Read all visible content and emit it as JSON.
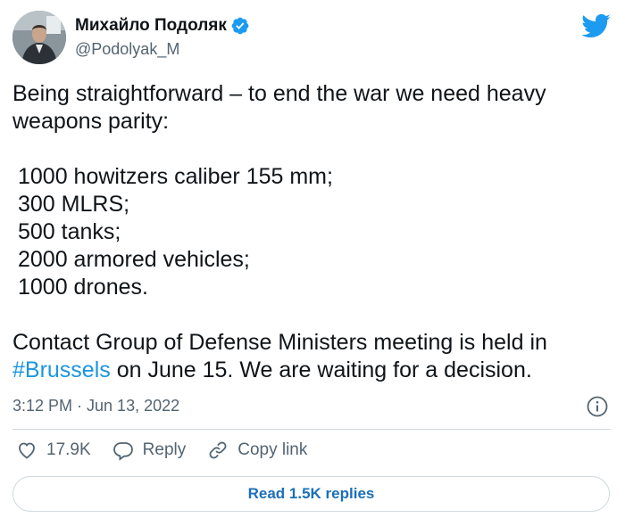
{
  "author": {
    "display_name": "Михайло Подоляк",
    "handle": "@Podolyak_M",
    "verified": true
  },
  "tweet": {
    "intro": "Being straightforward – to end the war we need heavy weapons parity:",
    "items": [
      "1000 howitzers caliber 155 mm;",
      "300 MLRS;",
      "500 tanks;",
      "2000 armored vehicles;",
      "1000 drones."
    ],
    "closing_before": "Contact Group of Defense Ministers meeting is held in",
    "hashtag": "#Brussels",
    "closing_after": " on June 15. We are waiting for a decision."
  },
  "meta": {
    "timestamp": "3:12 PM · Jun 13, 2022"
  },
  "actions": {
    "likes": "17.9K",
    "reply_label": "Reply",
    "copy_label": "Copy link"
  },
  "read_replies_label": "Read 1.5K replies",
  "colors": {
    "accent": "#1d9bf0",
    "hashtag": "#1b95e0",
    "secondary_text": "#536471",
    "border": "#cfd9de"
  },
  "icons": [
    "verified-badge-icon",
    "twitter-bird-icon",
    "info-icon",
    "heart-icon",
    "reply-icon",
    "link-icon"
  ]
}
